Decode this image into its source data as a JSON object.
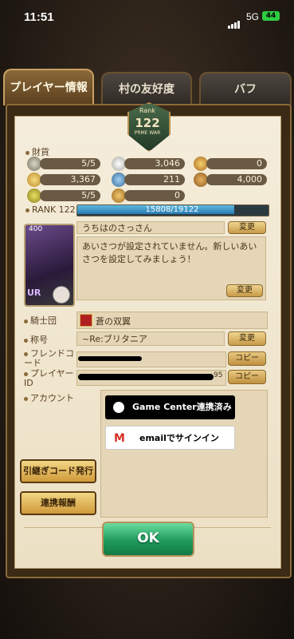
{
  "status_bar": {
    "time": "11:51",
    "network": "5G",
    "battery": "44"
  },
  "tabs": [
    {
      "label": "プレイヤー情報",
      "active": true
    },
    {
      "label": "村の友好度",
      "active": false
    },
    {
      "label": "バフ",
      "active": false
    }
  ],
  "emblem": {
    "rank_word": "Rank",
    "rank_value": "122",
    "sub": "PRME WAR"
  },
  "resources": {
    "title": "財貨",
    "items": [
      {
        "icon": "sword-icon",
        "value": "5/5"
      },
      {
        "icon": "silver-coin-icon",
        "value": "3,046"
      },
      {
        "icon": "gold-medal-icon",
        "value": "0"
      },
      {
        "icon": "gold-coin-icon",
        "value": "3,367"
      },
      {
        "icon": "blue-gem-icon",
        "value": "211"
      },
      {
        "icon": "bronze-medal-icon",
        "value": "4,000"
      },
      {
        "icon": "key-icon",
        "value": "5/5"
      },
      {
        "icon": "bag-icon",
        "value": "0"
      }
    ]
  },
  "rank": {
    "label": "RANK 122",
    "progress_text": "15808/19122",
    "progress": 0.8267
  },
  "profile": {
    "card_level": "400",
    "card_rarity": "UR",
    "name": "うちはのさっさん",
    "change_label": "変更",
    "greeting": "あいさつが設定されていません。新しいあいさつを設定してみましょう！",
    "greeting_change_label": "変更"
  },
  "details": {
    "knights_label": "騎士団",
    "knights_value": "蒼の双翼",
    "title_label": "称号",
    "title_value": "~Re:ブリタニア",
    "title_change_label": "変更",
    "friend_code_label": "フレンドコード",
    "copy_label": "コピー",
    "player_id_label": "プレイヤーID",
    "player_id_suffix": "95",
    "copy2_label": "コピー",
    "account_label": "アカウント"
  },
  "account": {
    "game_center_label": "Game Center連携済み",
    "email_label": "emailでサインイン"
  },
  "buttons": {
    "transfer_code": "引継ぎコード発行",
    "link_reward": "連携報酬",
    "ok": "OK"
  }
}
